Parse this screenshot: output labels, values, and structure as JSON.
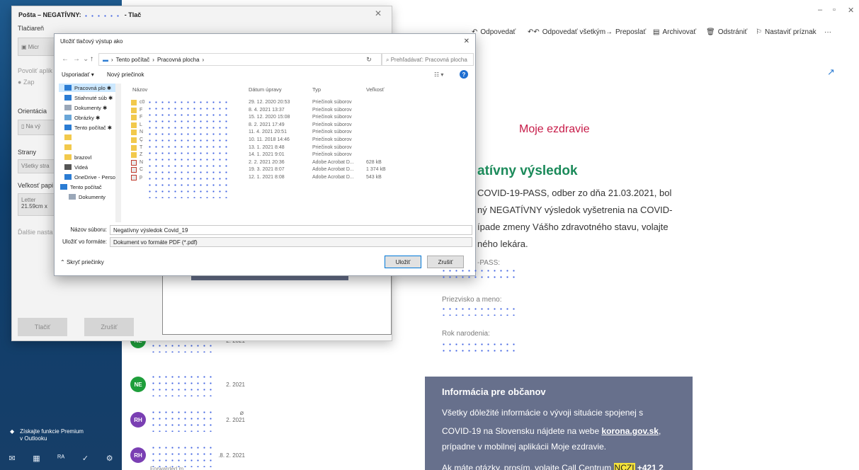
{
  "outlook": {
    "premium_label": "Získajte funkcie Premium v Outlooku",
    "bottom_icons": [
      "mail-icon",
      "calendar-icon",
      "people-icon",
      "todo-icon",
      "settings-icon"
    ],
    "mail_rows": [
      {
        "avatar": "NE",
        "color": "#1e9e3b",
        "date": "2. 2021"
      },
      {
        "avatar": "NE",
        "color": "#1e9e3b",
        "date": "2. 2021"
      },
      {
        "avatar": "RH",
        "color": "#7a3fb3",
        "date": "2. 2021"
      },
      {
        "avatar": "RH",
        "color": "#7a3fb3",
        "date": ".8. 2. 2021",
        "preview": "Forwarded m"
      }
    ]
  },
  "print": {
    "title": "Pošta – NEGATÍVNY:",
    "title_suffix": "- Tlač",
    "printer_label": "Tlačiareň",
    "printer_value": "Micr",
    "allow_label": "Povoliť aplik",
    "toggle_value": "Zap",
    "orientation_label": "Orientácia",
    "orientation_value": "Na vý",
    "pages_label": "Strany",
    "pages_value": "Všetky stra",
    "paper_label": "Veľkosť papi",
    "paper_value_1": "Letter",
    "paper_value_2": "21.59cm x",
    "more_label": "Ďalšie nasta",
    "print_button": "Tlačiť",
    "cancel_button": "Zrušiť"
  },
  "save": {
    "title": "Uložiť tlačový výstup ako",
    "address": [
      "Tento počítač",
      "›",
      "Pracovná plocha",
      "›"
    ],
    "search_placeholder": "Prehľadávať: Pracovná plocha",
    "organize": "Usporiadať ▾",
    "new_folder": "Nový priečinok",
    "nav_items": [
      {
        "label": "Pracovná plo ✱",
        "icon": "desktop-icon",
        "selected": true
      },
      {
        "label": "Stiahnuté súb ✱",
        "icon": "download-icon"
      },
      {
        "label": "Dokumenty ✱",
        "icon": "documents-icon"
      },
      {
        "label": "Obrázky ✱",
        "icon": "pictures-icon"
      },
      {
        "label": "Tento počítač ✱",
        "icon": "computer-icon"
      },
      {
        "label": "",
        "icon": "folder-icon"
      },
      {
        "label": "",
        "icon": "folder-icon"
      },
      {
        "label": "brazovl",
        "icon": "folder-icon"
      },
      {
        "label": "Videá",
        "icon": "videos-icon"
      },
      {
        "label": "OneDrive - Persor",
        "icon": "onedrive-icon"
      },
      {
        "label": "Tento počítač",
        "icon": "computer-icon"
      },
      {
        "label": "Dokumenty",
        "icon": "documents-icon"
      }
    ],
    "columns": {
      "name": "Názov",
      "date": "Dátum úpravy",
      "type": "Typ",
      "size": "Veľkosť"
    },
    "files": [
      {
        "prefix": "c0",
        "date": "29. 12. 2020 20:53",
        "type": "Priečinok súborov",
        "size": "",
        "kind": "folder"
      },
      {
        "prefix": "F",
        "date": "8. 4. 2021 13:37",
        "type": "Priečinok súborov",
        "size": "",
        "kind": "folder"
      },
      {
        "prefix": "F",
        "date": "15. 12. 2020 15:08",
        "type": "Priečinok súborov",
        "size": "",
        "kind": "folder"
      },
      {
        "prefix": "L",
        "date": "8. 2. 2021 17:49",
        "type": "Priečinok súborov",
        "size": "",
        "kind": "folder"
      },
      {
        "prefix": "N",
        "date": "11. 4. 2021 20:51",
        "type": "Priečinok súborov",
        "size": "",
        "kind": "folder"
      },
      {
        "prefix": "Ç",
        "date": "10. 11. 2018 14:46",
        "type": "Priečinok súborov",
        "size": "",
        "kind": "folder"
      },
      {
        "prefix": "T",
        "date": "13. 1. 2021 8:48",
        "type": "Priečinok súborov",
        "size": "",
        "kind": "folder"
      },
      {
        "prefix": "Z",
        "date": "14. 1. 2021 9:01",
        "type": "Priečinok súborov",
        "size": "",
        "kind": "folder"
      },
      {
        "prefix": "N",
        "date": "2. 2. 2021 20:36",
        "type": "Adobe Acrobat D...",
        "size": "628 kB",
        "kind": "pdf"
      },
      {
        "prefix": "C",
        "date": "19. 3. 2021 8:07",
        "type": "Adobe Acrobat D...",
        "size": "1 374 kB",
        "kind": "pdf"
      },
      {
        "prefix": "p",
        "date": "12. 1. 2021 8:08",
        "type": "Adobe Acrobat D...",
        "size": "543 kB",
        "kind": "pdf"
      }
    ],
    "filename_label": "Názov súboru:",
    "filename_value": "Negatívny výsledok Covid_19",
    "filetype_label": "Uložiť vo formáte:",
    "filetype_value": "Dokument vo formáte PDF (*.pdf)",
    "hide_folders": "Skryť priečinky",
    "save_button": "Uložiť",
    "cancel_button": "Zrušiť"
  },
  "reading": {
    "commands": [
      "Odpovedať",
      "Odpovedať všetkým",
      "Preposlať",
      "Archivovať",
      "Odstrániť",
      "Nastaviť príznak",
      "···"
    ],
    "moje": "Moje ezdravie",
    "heading": "atívny výsledok",
    "lines": [
      "COVID-19-PASS, odber zo dňa 21.03.2021, bol",
      "ný NEGATÍVNY výsledok vyšetrenia na COVID-",
      "ípade zmeny Vášho zdravotného stavu, volajte",
      "ného lekára."
    ],
    "pass_label": "-PASS:",
    "name_label": "Priezvisko a meno:",
    "birth_label": "Rok narodenia:",
    "info_title": "Informácia pre občanov",
    "info_line1": "Všetky dôležité informácie o vývoji situácie spojenej s",
    "info_line2_a": "COVID-19 na Slovensku nájdete na webe ",
    "info_link": "korona.gov.sk",
    "info_line2_b": ",",
    "info_line3": "prípadne v mobilnej aplikácii Moje ezdravie.",
    "info_line4_a": "Ak máte otázky, prosím, volajte Call Centrum ",
    "info_ncz": "NCZI",
    "info_line4_b": " +421 2"
  }
}
